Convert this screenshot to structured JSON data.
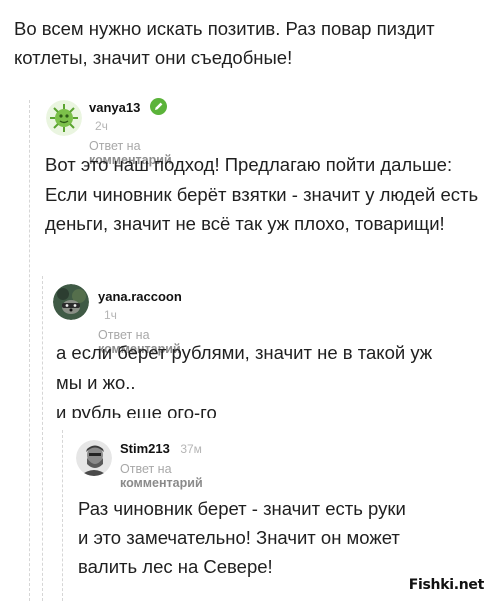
{
  "post": {
    "text": "Во всем нужно искать позитив. Раз повар пиздит котлеты, значит они съедобные!"
  },
  "comments": [
    {
      "username": "vanya13",
      "time": "2ч",
      "reply_prefix": "Ответ на",
      "reply_target": "комментарий",
      "avatar_icon": "green-virus-avatar",
      "badge_icon": "pencil-icon",
      "text": "Вот это наш подход! Предлагаю пойти дальше: Если чиновник берёт взятки - значит у людей есть деньги, значит не всё так уж плохо, товарищи!"
    },
    {
      "username": "yana.raccoon",
      "time": "1ч",
      "reply_prefix": "Ответ на",
      "reply_target": "комментарий",
      "avatar_icon": "raccoon-avatar",
      "text_line1": "а если берет рублями, значит не в такой уж",
      "text_line2": "мы и жо..",
      "text_line3": "и рубль еще ого-го"
    },
    {
      "username": "Stim213",
      "time": "37м",
      "reply_prefix": "Ответ на",
      "reply_target": "комментарий",
      "avatar_icon": "man-portrait-avatar",
      "text": "Раз чиновник берет - значит есть руки и это замечательно! Значит он может валить лес на Севере!"
    }
  ],
  "watermark": "Fishki.net",
  "colors": {
    "accent_green": "#5bb33a",
    "muted_text": "#a8a8a8",
    "thread_line": "#d6d6d6"
  }
}
